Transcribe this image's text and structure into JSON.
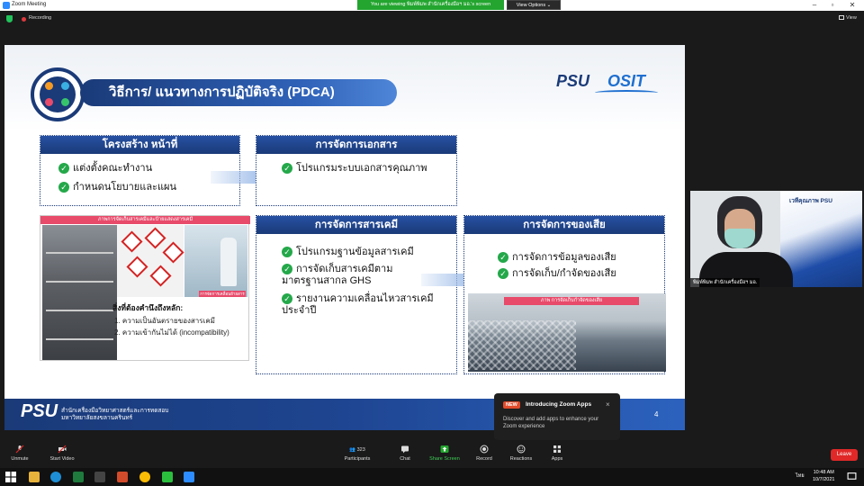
{
  "window": {
    "title": "Zoom Meeting"
  },
  "recording": {
    "label": "Recording"
  },
  "banner": {
    "viewing": "You are viewing พิมพ์พิมพ สำนักเครื่องมือฯ มอ.'s screen",
    "view_options": "View Options ⌄"
  },
  "view_button": {
    "label": "View"
  },
  "slide": {
    "title": "วิธีการ/ แนวทางการปฏิบัติจริง (PDCA)",
    "logo_psu": "PSU",
    "logo_osit": "OSIT",
    "box_structure": {
      "title": "โครงสร้าง หน้าที่",
      "items": [
        "แต่งตั้งคณะทำงาน",
        "กำหนดนโยบายและแผน"
      ]
    },
    "box_docs": {
      "title": "การจัดการเอกสาร",
      "items": [
        "โปรแกรมระบบเอกสารคุณภาพ"
      ]
    },
    "box_chem": {
      "title": "การจัดการสารเคมี",
      "items": [
        "โปรแกรมฐานข้อมูลสารเคมี",
        "การจัดเก็บสารเคมีตามมาตรฐานสากล GHS",
        "รายงานความเคลื่อนไหวสารเคมีประจำปี"
      ]
    },
    "box_waste": {
      "title": "การจัดการของเสีย",
      "items": [
        "การจัดการข้อมูลของเสีย",
        "การจัดเก็บ/กำจัดของเสีย"
      ]
    },
    "photo_caption": "ภาพการจัดเก็บสารเคมีและป้ายแสดงสารเคมี",
    "lab_caption": "การจัดการเคลื่อนย้ายสารเคมี",
    "note_title": "สิ่งที่ต้องคำนึงถึงหลัก:",
    "note_lines": [
      "1. ความเป็นอันตรายของสารเคมี",
      "2. ความเข้ากันไม่ได้ (incompatibility)"
    ],
    "waste_caption": "ภาพ การจัดเก็บกำจัดของเสีย",
    "footer_logo": "PSU",
    "footer_text": [
      "สำนักเครื่องมือวิทยาศาสตร์และการทดสอบ",
      "มหาวิทยาลัยสงขลานครินทร์"
    ],
    "page_number": "4"
  },
  "speaker": {
    "name": "พิมพ์พิมพ สำนักเครื่องมือฯ มอ.",
    "banner_text": "เวทีคุณภาพ PSU"
  },
  "toast": {
    "badge": "NEW",
    "title": "Introducing Zoom Apps",
    "body": "Discover and add apps to enhance your Zoom experience",
    "close": "×"
  },
  "controls": {
    "unmute": "Unmute",
    "start_video": "Start Video",
    "participants": "Participants",
    "participant_count": "323",
    "chat": "Chat",
    "share_screen": "Share Screen",
    "record": "Record",
    "reactions": "Reactions",
    "apps": "Apps",
    "leave": "Leave"
  },
  "taskbar": {
    "time": "10:48 AM",
    "date": "10/7/2021",
    "lang": "ไทย"
  },
  "colors": {
    "navy": "#1a3a78",
    "green_check": "#24a84a",
    "leave_red": "#e02828",
    "share_green": "#23a52f"
  }
}
